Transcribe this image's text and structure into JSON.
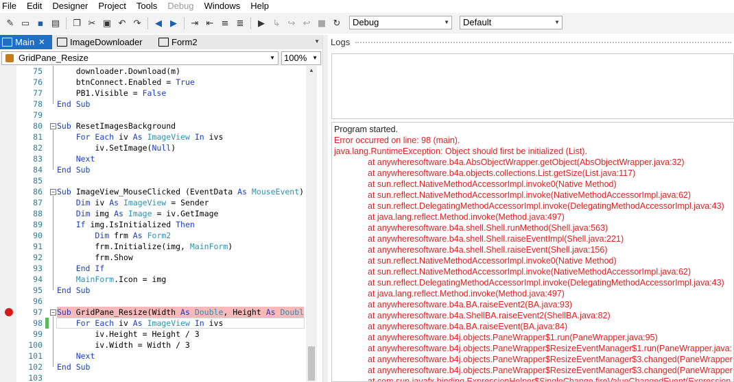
{
  "menu": [
    "File",
    "Edit",
    "Designer",
    "Project",
    "Tools",
    "Debug",
    "Windows",
    "Help"
  ],
  "toolbar": {
    "config_select": "Debug",
    "platform_select": "Default"
  },
  "tabs": [
    {
      "label": "Main",
      "close": "✕",
      "active": true
    },
    {
      "label": "ImageDownloader",
      "active": false
    },
    {
      "label": "Form2",
      "active": false
    }
  ],
  "editor": {
    "sub_select": "GridPane_Resize",
    "zoom": "100%",
    "lines": [
      {
        "n": "75",
        "text": "    downloader.Download(m)"
      },
      {
        "n": "76",
        "text": "    btnConnect.Enabled = True"
      },
      {
        "n": "77",
        "text": "    PB1.Visible = False"
      },
      {
        "n": "78",
        "text": "End Sub"
      },
      {
        "n": "79",
        "text": ""
      },
      {
        "n": "80",
        "text": "Sub ResetImagesBackground"
      },
      {
        "n": "81",
        "text": "    For Each iv As ImageView In ivs"
      },
      {
        "n": "82",
        "text": "        iv.SetImage(Null)"
      },
      {
        "n": "83",
        "text": "    Next"
      },
      {
        "n": "84",
        "text": "End Sub"
      },
      {
        "n": "85",
        "text": ""
      },
      {
        "n": "86",
        "text": "Sub ImageView_MouseClicked (EventData As MouseEvent)"
      },
      {
        "n": "87",
        "text": "    Dim iv As ImageView = Sender"
      },
      {
        "n": "88",
        "text": "    Dim img As Image = iv.GetImage"
      },
      {
        "n": "89",
        "text": "    If img.IsInitialized Then"
      },
      {
        "n": "90",
        "text": "        Dim frm As Form2"
      },
      {
        "n": "91",
        "text": "        frm.Initialize(img, MainForm)"
      },
      {
        "n": "92",
        "text": "        frm.Show"
      },
      {
        "n": "93",
        "text": "    End If"
      },
      {
        "n": "94",
        "text": "    MainForm.Icon = img"
      },
      {
        "n": "95",
        "text": "End Sub"
      },
      {
        "n": "96",
        "text": ""
      },
      {
        "n": "97",
        "text": "Sub GridPane_Resize(Width As Double, Height As Doubl"
      },
      {
        "n": "98",
        "text": "    For Each iv As ImageView In ivs"
      },
      {
        "n": "99",
        "text": "        iv.Height = Height / 3"
      },
      {
        "n": "100",
        "text": "        iv.Width = Width / 3"
      },
      {
        "n": "101",
        "text": "    Next"
      },
      {
        "n": "102",
        "text": "End Sub"
      },
      {
        "n": "103",
        "text": ""
      }
    ]
  },
  "logs": {
    "title": "Logs",
    "lines": [
      {
        "kind": "norm",
        "text": "Program started."
      },
      {
        "kind": "err",
        "text": "Error occurred on line: 98 (main)."
      },
      {
        "kind": "err",
        "text": "java.lang.RuntimeException: Object should first be initialized (List)."
      },
      {
        "kind": "err-i",
        "text": "at anywheresoftware.b4a.AbsObjectWrapper.getObject(AbsObjectWrapper.java:32)"
      },
      {
        "kind": "err-i",
        "text": "at anywheresoftware.b4a.objects.collections.List.getSize(List.java:117)"
      },
      {
        "kind": "err-i",
        "text": "at sun.reflect.NativeMethodAccessorImpl.invoke0(Native Method)"
      },
      {
        "kind": "err-i",
        "text": "at sun.reflect.NativeMethodAccessorImpl.invoke(NativeMethodAccessorImpl.java:62)"
      },
      {
        "kind": "err-i",
        "text": "at sun.reflect.DelegatingMethodAccessorImpl.invoke(DelegatingMethodAccessorImpl.java:43)"
      },
      {
        "kind": "err-i",
        "text": "at java.lang.reflect.Method.invoke(Method.java:497)"
      },
      {
        "kind": "err-i",
        "text": "at anywheresoftware.b4a.shell.Shell.runMethod(Shell.java:563)"
      },
      {
        "kind": "err-i",
        "text": "at anywheresoftware.b4a.shell.Shell.raiseEventImpl(Shell.java:221)"
      },
      {
        "kind": "err-i",
        "text": "at anywheresoftware.b4a.shell.Shell.raiseEvent(Shell.java:156)"
      },
      {
        "kind": "err-i",
        "text": "at sun.reflect.NativeMethodAccessorImpl.invoke0(Native Method)"
      },
      {
        "kind": "err-i",
        "text": "at sun.reflect.NativeMethodAccessorImpl.invoke(NativeMethodAccessorImpl.java:62)"
      },
      {
        "kind": "err-i",
        "text": "at sun.reflect.DelegatingMethodAccessorImpl.invoke(DelegatingMethodAccessorImpl.java:43)"
      },
      {
        "kind": "err-i",
        "text": "at java.lang.reflect.Method.invoke(Method.java:497)"
      },
      {
        "kind": "err-i",
        "text": "at anywheresoftware.b4a.BA.raiseEvent2(BA.java:93)"
      },
      {
        "kind": "err-i",
        "text": "at anywheresoftware.b4a.ShellBA.raiseEvent2(ShellBA.java:82)"
      },
      {
        "kind": "err-i",
        "text": "at anywheresoftware.b4a.BA.raiseEvent(BA.java:84)"
      },
      {
        "kind": "err-i",
        "text": "at anywheresoftware.b4j.objects.PaneWrapper$1.run(PaneWrapper.java:95)"
      },
      {
        "kind": "err-i",
        "text": "at anywheresoftware.b4j.objects.PaneWrapper$ResizeEventManager$1.run(PaneWrapper.java:"
      },
      {
        "kind": "err-i",
        "text": "at anywheresoftware.b4j.objects.PaneWrapper$ResizeEventManager$3.changed(PaneWrapper"
      },
      {
        "kind": "err-i",
        "text": "at anywheresoftware.b4j.objects.PaneWrapper$ResizeEventManager$3.changed(PaneWrapper"
      },
      {
        "kind": "err-i",
        "text": "at com.sun.javafx.binding.ExpressionHelper$SingleChange.fireValueChangedEvent(Expression"
      }
    ]
  }
}
